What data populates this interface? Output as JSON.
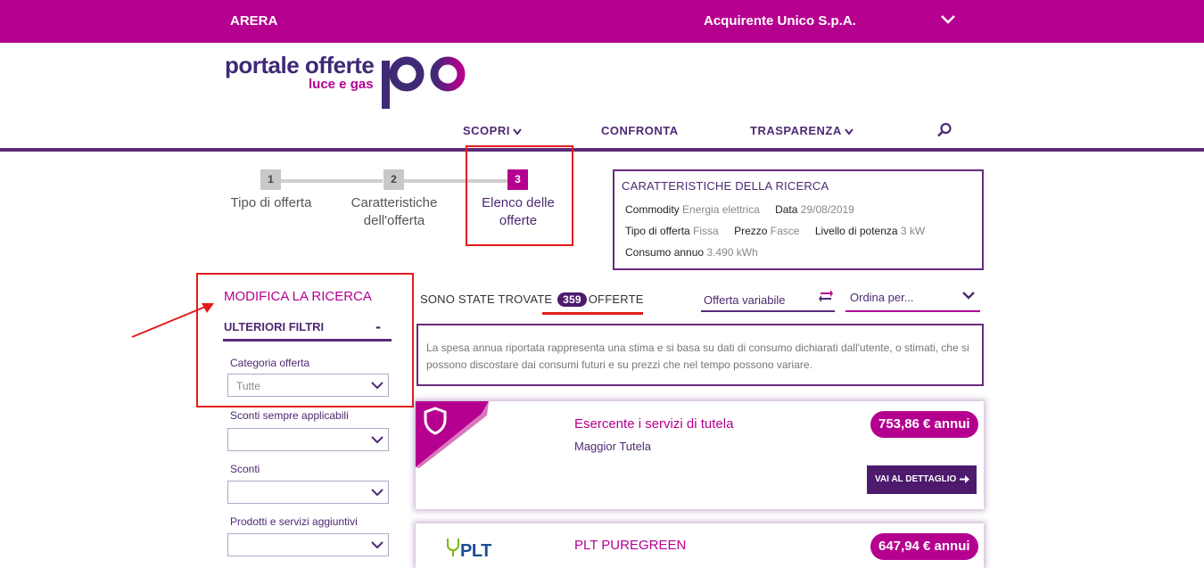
{
  "topbar": {
    "left_label": "ARERA",
    "center_label": "Acquirente Unico S.p.A."
  },
  "logo": {
    "line1": "portale offerte",
    "line2": "luce e gas"
  },
  "nav": {
    "items": [
      {
        "label": "SCOPRI"
      },
      {
        "label": "CONFRONTA"
      },
      {
        "label": "TRASPARENZA"
      }
    ]
  },
  "stepper": {
    "steps": [
      {
        "num": "1",
        "label_line1": "Tipo di offerta",
        "label_line2": ""
      },
      {
        "num": "2",
        "label_line1": "Caratteristiche",
        "label_line2": "dell'offerta"
      },
      {
        "num": "3",
        "label_line1": "Elenco delle",
        "label_line2": "offerte"
      }
    ]
  },
  "search_chars": {
    "title": "CARATTERISTICHE DELLA RICERCA",
    "commodity_k": "Commodity",
    "commodity_v": "Energia elettrica",
    "data_k": "Data",
    "data_v": "29/08/2019",
    "tipo_k": "Tipo di offerta",
    "tipo_v": "Fissa",
    "prezzo_k": "Prezzo",
    "prezzo_v": "Fasce",
    "potenza_k": "Livello di potenza",
    "potenza_v": "3 kW",
    "consumo_k": "Consumo annuo",
    "consumo_v": "3.490 kWh"
  },
  "filters": {
    "title": "MODIFICA LA RICERCA",
    "section": "ULTERIORI FILTRI",
    "collapse": "-",
    "items": [
      {
        "label": "Categoria offerta",
        "value": "Tutte"
      },
      {
        "label": "Sconti sempre applicabili",
        "value": ""
      },
      {
        "label": "Sconti",
        "value": ""
      },
      {
        "label": "Prodotti e servizi aggiuntivi",
        "value": ""
      }
    ]
  },
  "results": {
    "found_prefix": "SONO STATE TROVATE",
    "count": "359",
    "found_suffix": "OFFERTE",
    "toggle_label": "Offerta variabile",
    "sort_label": "Ordina per...",
    "disclaimer": "La spesa annua riportata rappresenta una stima e si basa su dati di consumo dichiarati dall'utente, o stimati, che si possono discostare dai consumi futuri e su prezzi che nel tempo possono variare."
  },
  "offers": [
    {
      "name": "Esercente i servizi di tutela",
      "subtitle": "Maggior Tutela",
      "price": "753,86 € annui",
      "detail_label": "VAI AL DETTAGLIO"
    },
    {
      "name": "PLT PUREGREEN",
      "logo_text": "PLT",
      "price": "647,94 € annui"
    }
  ],
  "colors": {
    "brand_magenta": "#b5008f",
    "brand_purple": "#4d1a6e",
    "highlight_red": "#e31b1b"
  }
}
